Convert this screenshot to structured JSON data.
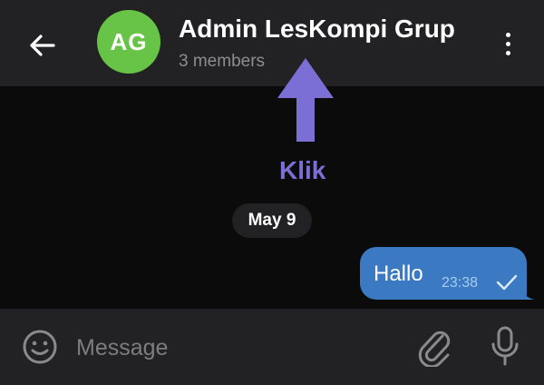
{
  "header": {
    "avatar_initials": "AG",
    "avatar_color": "#68c446",
    "title": "Admin LesKompi Grup",
    "subtitle": "3 members"
  },
  "annotation": {
    "label": "Klik",
    "color": "#7b6fd6"
  },
  "chat": {
    "date_chip": "May 9",
    "messages": [
      {
        "text": "Hallo",
        "time": "23:38",
        "status": "sent-check-icon",
        "bubble_color": "#3b79c2"
      }
    ]
  },
  "composer": {
    "placeholder": "Message"
  },
  "icons": {
    "back": "arrow-left-icon",
    "menu": "more-vertical-icon",
    "emoji": "smile-icon",
    "attach": "paperclip-icon",
    "mic": "microphone-icon"
  }
}
